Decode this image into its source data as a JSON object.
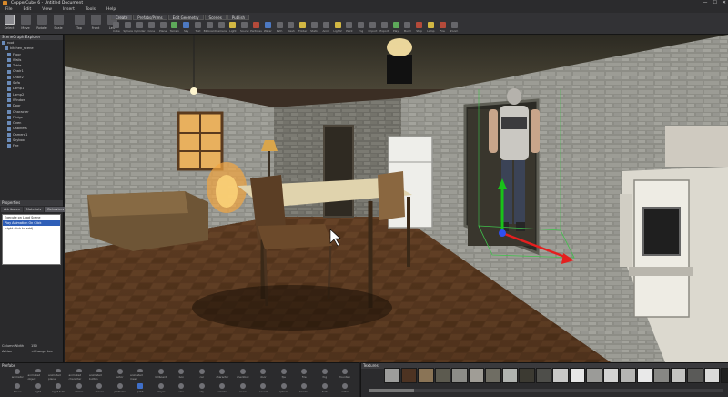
{
  "window": {
    "title": "CopperCube 6 - Untitled Document",
    "controls": [
      "—",
      "☐",
      "✕"
    ]
  },
  "menu": [
    "File",
    "Edit",
    "View",
    "Insert",
    "Tools",
    "Help"
  ],
  "toolbar": {
    "left_buttons": [
      {
        "label": "Select",
        "icon": "cursor-icon"
      },
      {
        "label": "Move",
        "icon": "move-icon"
      },
      {
        "label": "Rotate",
        "icon": "rotate-icon"
      },
      {
        "label": "Scale",
        "icon": "scale-icon"
      },
      {
        "label": "",
        "icon": "separator"
      },
      {
        "label": "Top",
        "icon": "view-top-icon"
      },
      {
        "label": "Front",
        "icon": "view-front-icon"
      },
      {
        "label": "Left",
        "icon": "view-left-icon"
      }
    ],
    "tabs": [
      "Create",
      "Prefabs/Prims",
      "Edit Geometry",
      "Scenes",
      "Publish"
    ],
    "selected_tab": 0,
    "icons": [
      "Cube",
      "Sphere",
      "Cylinder",
      "Cone",
      "Plane",
      "Terrain",
      "Sky",
      "Text",
      "Billboard",
      "Camera",
      "Light",
      "Sound",
      "Particles",
      "Water",
      "Path",
      "Mesh",
      "Folder",
      "Static",
      "Anim",
      "Light2",
      "Paint",
      "Fog",
      "Import",
      "Export",
      "Play",
      "Build",
      "Stop",
      "Lamp",
      "Fire",
      "Zoom"
    ]
  },
  "explorer": {
    "title": "SceneGraph Explorer",
    "items": [
      "root",
      "kitchen_scene",
      "Floor",
      "Walls",
      "Table",
      "Chair1",
      "Chair2",
      "Sofa",
      "Lamp1",
      "Lamp2",
      "Window",
      "Door",
      "Character",
      "Fridge",
      "Oven",
      "Cabinets",
      "Camera1",
      "Skybox",
      "Fire"
    ]
  },
  "properties": {
    "title": "Properties",
    "tabs": [
      "Attributes",
      "Materials",
      "Behaviors"
    ],
    "selected_tab": 2,
    "behaviors": [
      {
        "label": "Execute on Load Scene",
        "selected": false
      },
      {
        "label": "Play Animation On Click",
        "selected": true
      },
      {
        "label": "(right-click to add)",
        "selected": false
      }
    ],
    "fields": [
      {
        "key": "ColumnWidth",
        "value": "150"
      },
      {
        "key": "Action",
        "value": "<Change to>"
      }
    ]
  },
  "presets": {
    "title": "Prefabs",
    "items": [
      "animator",
      "animated object",
      "animated plane",
      "animated character",
      "animated button",
      "actor",
      "animated mesh",
      "billboard",
      "box",
      "car",
      "character",
      "checkbox",
      "door",
      "fps",
      "fire",
      "fog",
      "fountain",
      "house",
      "light",
      "light bulb",
      "mirror",
      "mover",
      "particles",
      "path",
      "player",
      "rain",
      "sky",
      "smoke",
      "snow",
      "sound",
      "sphere",
      "terrain",
      "text",
      "water"
    ],
    "selected": 23
  },
  "textures": {
    "title": "Textures",
    "swatches": [
      "#9d9d9b",
      "#4d3322",
      "#8a7456",
      "#5c5a4f",
      "#8c8c88",
      "#a09d96",
      "#6f6d63",
      "#b0b3b0",
      "#3c3a32",
      "#4e4e4a",
      "#c9c9c8",
      "#e6e6e6",
      "#9b9b98",
      "#d3d3d3",
      "#b5b5b3",
      "#e9e9e9",
      "#878784",
      "#c4c4c2",
      "#5a5a58",
      "#dadad9",
      "#202020"
    ]
  }
}
